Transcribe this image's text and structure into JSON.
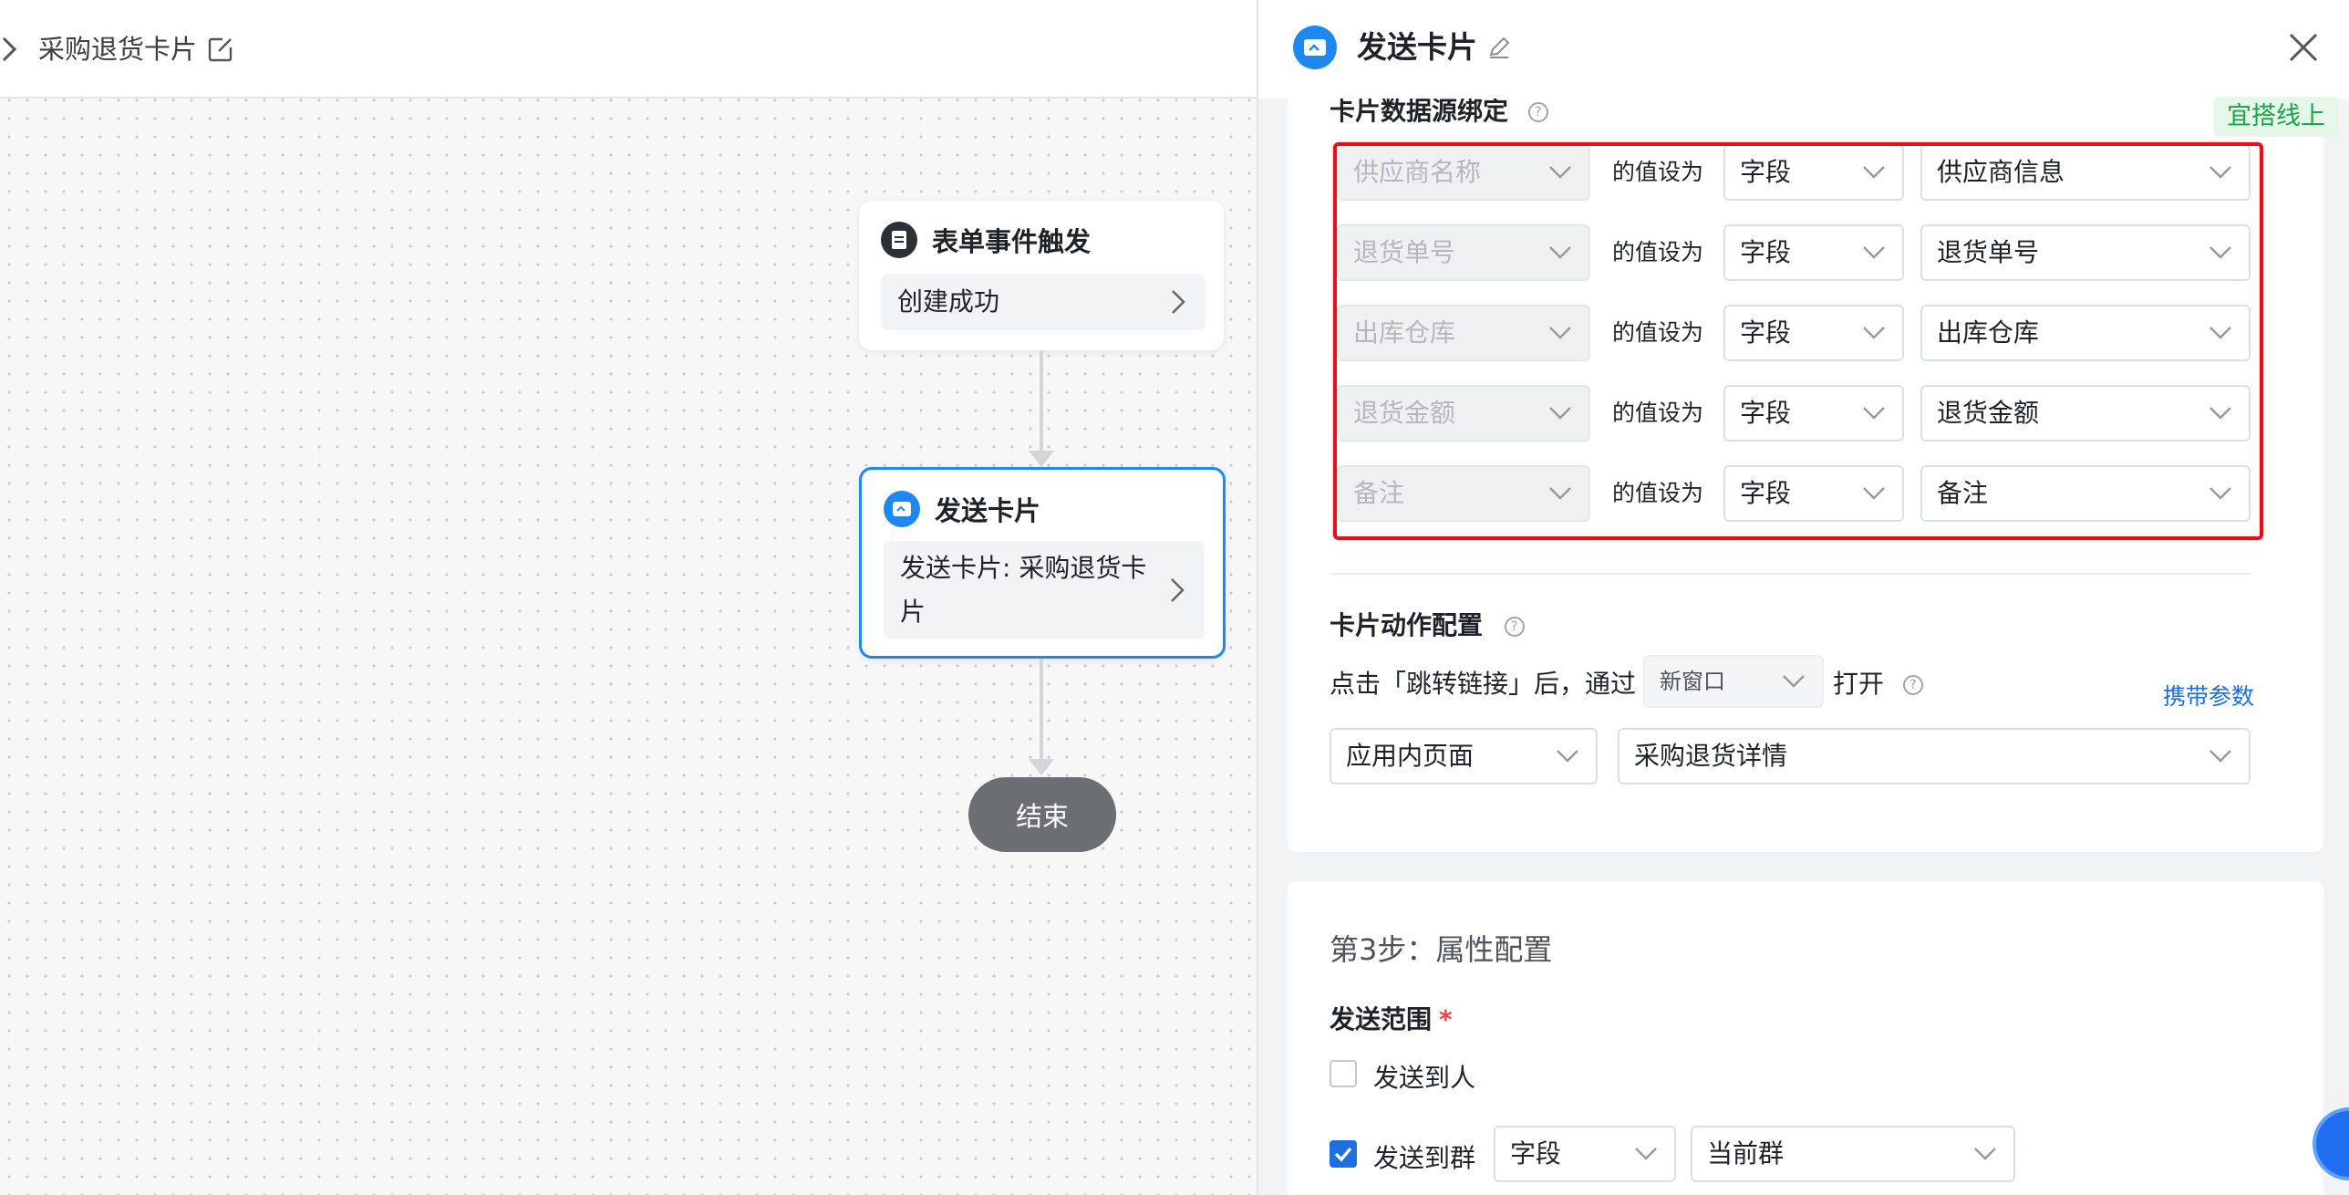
{
  "canvas": {
    "flow_title": "采购退货卡片",
    "trigger_node": {
      "title": "表单事件触发",
      "body": "创建成功"
    },
    "send_node": {
      "title": "发送卡片",
      "body": "发送卡片: 采购退货卡片"
    },
    "end_node": {
      "label": "结束"
    }
  },
  "drawer": {
    "title": "发送卡片",
    "data_binding_label": "卡片数据源绑定",
    "env_badge": "宜搭线上",
    "bindings": [
      {
        "field": "供应商名称",
        "connector": "的值设为",
        "type": "字段",
        "value": "供应商信息"
      },
      {
        "field": "退货单号",
        "connector": "的值设为",
        "type": "字段",
        "value": "退货单号"
      },
      {
        "field": "出库仓库",
        "connector": "的值设为",
        "type": "字段",
        "value": "出库仓库"
      },
      {
        "field": "退货金额",
        "connector": "的值设为",
        "type": "字段",
        "value": "退货金额"
      },
      {
        "field": "备注",
        "connector": "的值设为",
        "type": "字段",
        "value": "备注"
      }
    ],
    "action_config": {
      "label": "卡片动作配置",
      "prefix": "点击「跳转链接」后，通过",
      "open_mode": "新窗口",
      "suffix": "打开",
      "carry_params": "携带参数",
      "page_type": "应用内页面",
      "target_page": "采购退货详情"
    },
    "step3": {
      "title": "第3步：属性配置",
      "scope_label": "发送范围",
      "required_mark": "*",
      "option_person": "发送到人",
      "option_group": "发送到群",
      "group_type": "字段",
      "group_value": "当前群"
    }
  },
  "colors": {
    "accent": "#1e88f0",
    "highlight": "#e0101c",
    "env_badge_text": "#1aa34a"
  }
}
